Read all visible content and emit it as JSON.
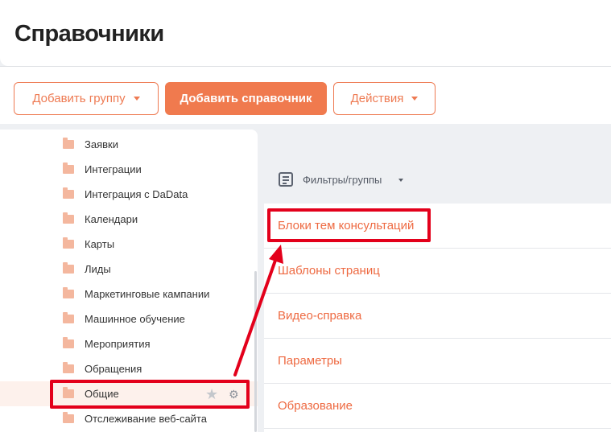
{
  "header": {
    "title": "Справочники"
  },
  "toolbar": {
    "add_group": "Добавить группу",
    "add_reference": "Добавить справочник",
    "actions": "Действия"
  },
  "sidebar": {
    "items": [
      {
        "label": "Заявки"
      },
      {
        "label": "Интеграции"
      },
      {
        "label": "Интеграция с DaData"
      },
      {
        "label": "Календари"
      },
      {
        "label": "Карты"
      },
      {
        "label": "Лиды"
      },
      {
        "label": "Маркетинговые кампании"
      },
      {
        "label": "Машинное обучение"
      },
      {
        "label": "Мероприятия"
      },
      {
        "label": "Обращения"
      },
      {
        "label": "Общие",
        "active": true
      },
      {
        "label": "Отслеживание веб-сайта"
      }
    ]
  },
  "main": {
    "filter_label": "Фильтры/группы",
    "references": [
      {
        "label": "Блоки тем консультаций"
      },
      {
        "label": "Шаблоны страниц"
      },
      {
        "label": "Видео-справка"
      },
      {
        "label": "Параметры"
      },
      {
        "label": "Образование"
      }
    ]
  },
  "icons": {
    "folder": "folder-icon",
    "star": "star-icon",
    "gear": "gear-icon",
    "filter": "filter-list-icon"
  },
  "colors": {
    "accent": "#f07a4e",
    "link": "#ee6a42",
    "annotation": "#e3001b"
  }
}
